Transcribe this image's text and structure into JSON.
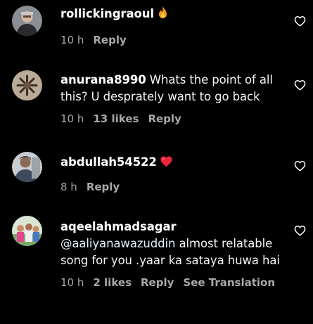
{
  "comments": [
    {
      "username": "rollickingraoul",
      "text": "",
      "emoji": "fire",
      "time": "10 h",
      "likes": "",
      "reply": "Reply",
      "see_translation": ""
    },
    {
      "username": "anurana8990",
      "text": "Whats the point of all this? U desprately want to go back",
      "emoji": "",
      "time": "10 h",
      "likes": "13 likes",
      "reply": "Reply",
      "see_translation": ""
    },
    {
      "username": "abdullah54522",
      "text": "",
      "emoji": "red-heart",
      "time": "8 h",
      "likes": "",
      "reply": "Reply",
      "see_translation": ""
    },
    {
      "username": "aqeelahmadsagar",
      "mention": "@aaliyanawazuddin",
      "text": "almost relatable song for you .yaar ka sataya huwa hai",
      "emoji": "",
      "time": "10 h",
      "likes": "2 likes",
      "reply": "Reply",
      "see_translation": "See Translation"
    }
  ],
  "icons": {
    "like": "heart-outline-icon",
    "fire": "fire-emoji-icon",
    "red_heart": "red-heart-emoji-icon"
  },
  "colors": {
    "background": "#000000",
    "primary_text": "#f5f5f5",
    "secondary_text": "#a8a8a8",
    "emoji_heart": "#e8263d",
    "emoji_fire": "#f7931e"
  }
}
